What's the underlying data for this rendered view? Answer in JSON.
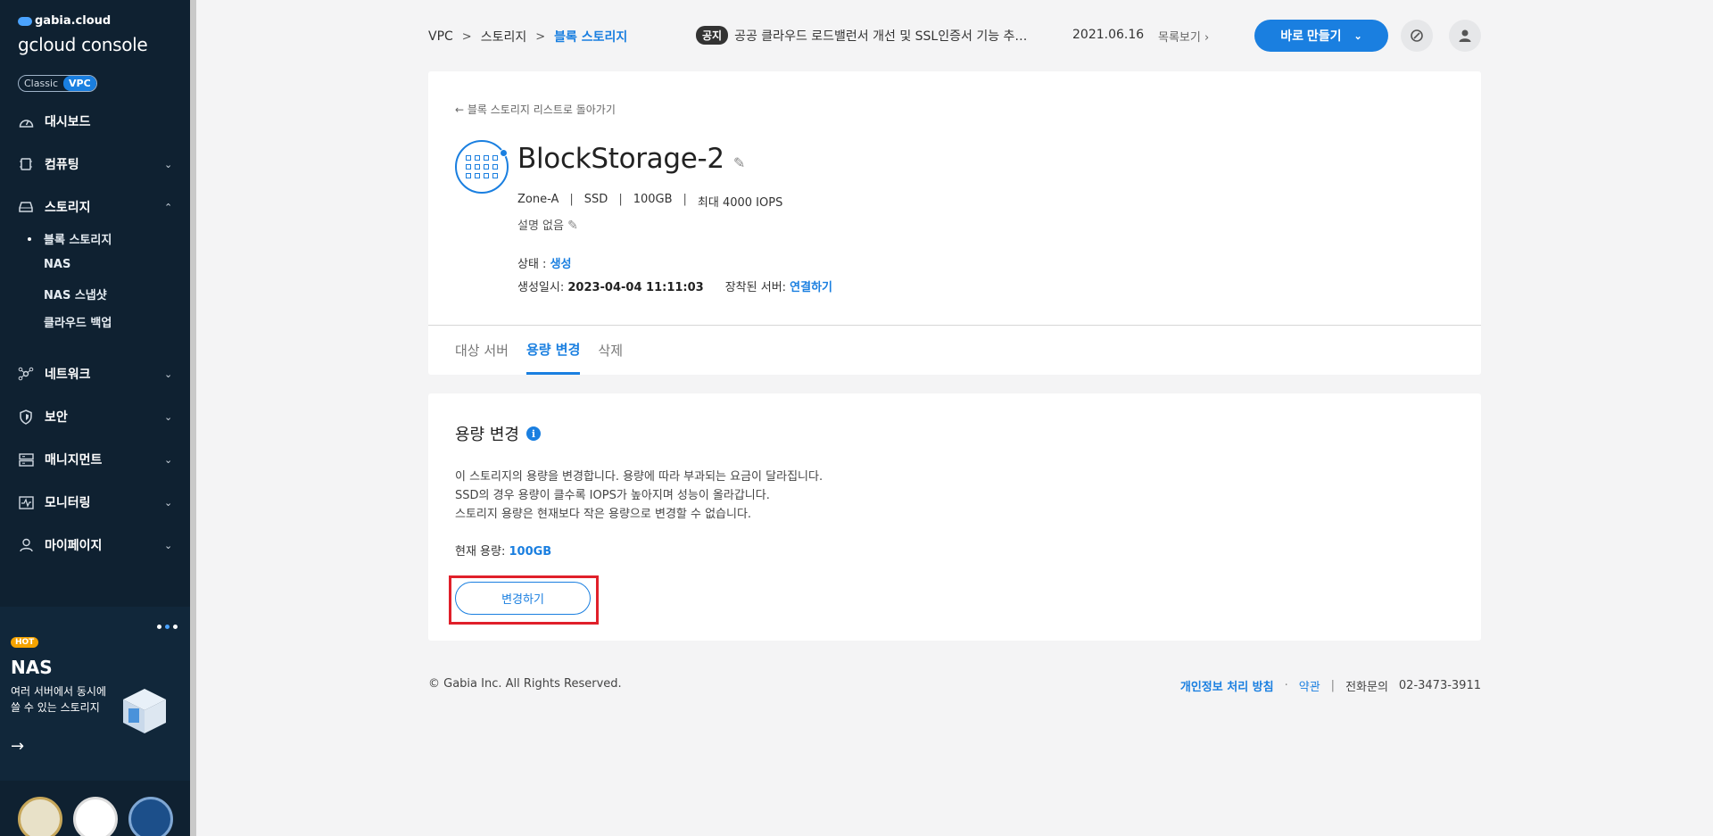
{
  "sidebar": {
    "logo_small": "gabia.cloud",
    "logo_big": "gcloud console",
    "mode": {
      "classic": "Classic",
      "vpc": "VPC"
    },
    "items": [
      {
        "label": "대시보드",
        "icon": "dashboard-icon"
      },
      {
        "label": "컴퓨팅",
        "icon": "chip-icon"
      },
      {
        "label": "스토리지",
        "icon": "storage-icon"
      },
      {
        "label": "네트워크",
        "icon": "network-icon"
      },
      {
        "label": "보안",
        "icon": "shield-icon"
      },
      {
        "label": "매니지먼트",
        "icon": "management-icon"
      },
      {
        "label": "모니터링",
        "icon": "monitoring-icon"
      },
      {
        "label": "마이페이지",
        "icon": "user-icon"
      }
    ],
    "storage_sub": [
      {
        "label": "블록 스토리지",
        "active": true
      },
      {
        "label": "NAS"
      },
      {
        "label": "NAS 스냅샷"
      },
      {
        "label": "클라우드 백업"
      }
    ],
    "promo": {
      "badge": "HOT",
      "title": "NAS",
      "desc_line1": "여러 서버에서 동시에",
      "desc_line2": "쓸 수 있는 스토리지"
    }
  },
  "breadcrumb": {
    "item1": "VPC",
    "item2": "스토리지",
    "current": "블록 스토리지"
  },
  "notice": {
    "tag": "공지",
    "text": "공공 클라우드 로드밸런서 개선 및 SSL인증서 기능 추…",
    "date": "2021.06.16",
    "more": "목록보기"
  },
  "create_button": "바로 만들기",
  "detail": {
    "back_link": "블록 스토리지 리스트로 돌아가기",
    "name": "BlockStorage-2",
    "zone": "Zone-A",
    "type": "SSD",
    "size": "100GB",
    "iops": "최대 4000 IOPS",
    "description": "설명 없음",
    "status_label": "상태 : ",
    "status_value": "생성",
    "created_label": "생성일시: ",
    "created_value": "2023-04-04 11:11:03",
    "server_label": "장착된 서버: ",
    "server_value": "연결하기",
    "tabs": [
      "대상 서버",
      "용량 변경",
      "삭제"
    ]
  },
  "capacity": {
    "title": "용량 변경",
    "line1": "이 스토리지의 용량을 변경합니다. 용량에 따라 부과되는 요금이 달라집니다.",
    "line2": "SSD의 경우 용량이 클수록 IOPS가 높아지며 성능이 올라갑니다.",
    "line3": "스토리지 용량은 현재보다 작은 용량으로 변경할 수 없습니다.",
    "current_label": "현재 용량: ",
    "current_value": "100GB",
    "button": "변경하기"
  },
  "footer": {
    "copyright": "© Gabia Inc. All Rights Reserved.",
    "privacy": "개인정보 처리 방침",
    "terms": "약관",
    "phone_label": "전화문의",
    "phone": "02-3473-3911"
  },
  "colors": {
    "accent": "#1a7fe0",
    "sidebar_bg": "#0f2131",
    "highlight": "#e0202a"
  }
}
